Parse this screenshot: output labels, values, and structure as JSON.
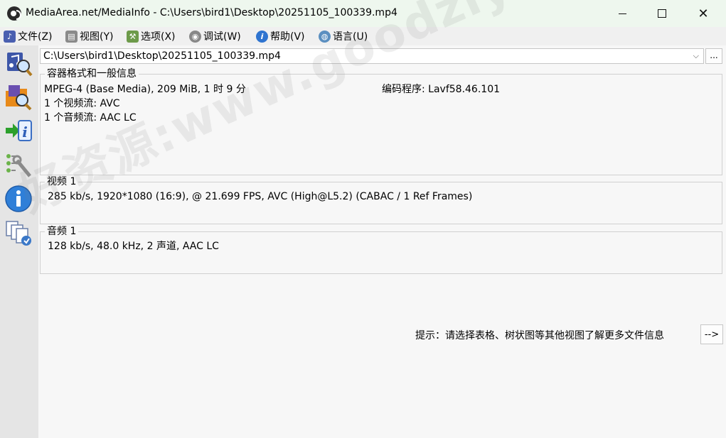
{
  "window": {
    "title": "MediaArea.net/MediaInfo - C:\\Users\\bird1\\Desktop\\20251105_100339.mp4",
    "minimize": "—",
    "maximize": "☐",
    "close": "✕"
  },
  "menu": [
    {
      "label": "文件(Z)",
      "icon": "file-icon"
    },
    {
      "label": "视图(Y)",
      "icon": "view-icon"
    },
    {
      "label": "选项(X)",
      "icon": "options-icon"
    },
    {
      "label": "调试(W)",
      "icon": "debug-icon"
    },
    {
      "label": "帮助(V)",
      "icon": "help-icon"
    },
    {
      "label": "语言(U)",
      "icon": "language-icon"
    }
  ],
  "toolbar": [
    {
      "name": "open-file",
      "icon": "open-file-icon"
    },
    {
      "name": "open-folder",
      "icon": "open-folder-icon"
    },
    {
      "name": "export",
      "icon": "export-icon"
    },
    {
      "name": "preferences",
      "icon": "preferences-icon"
    },
    {
      "name": "about",
      "icon": "about-icon"
    },
    {
      "name": "donate",
      "icon": "donate-icon"
    }
  ],
  "file": {
    "path": "C:\\Users\\bird1\\Desktop\\20251105_100339.mp4",
    "browse": "..."
  },
  "general": {
    "title": "容器格式和一般信息",
    "format": "MPEG-4 (Base Media), 209 MiB, 1 时 9 分",
    "encoder": "编码程序: Lavf58.46.101",
    "video_count": "1 个视频流: AVC",
    "audio_count": "1 个音频流: AAC LC"
  },
  "video": {
    "title": "视频 1",
    "info": "285 kb/s, 1920*1080 (16:9), @ 21.699 FPS, AVC (High@L5.2) (CABAC / 1 Ref Frames)"
  },
  "audio": {
    "title": "音频 1",
    "info": "128 kb/s, 48.0 kHz, 2 声道, AAC LC"
  },
  "hint": {
    "text": "提示：请选择表格、树状图等其他视图了解更多文件信息",
    "next": "-->"
  },
  "watermark": "好资源:www.goodziyuan.com"
}
